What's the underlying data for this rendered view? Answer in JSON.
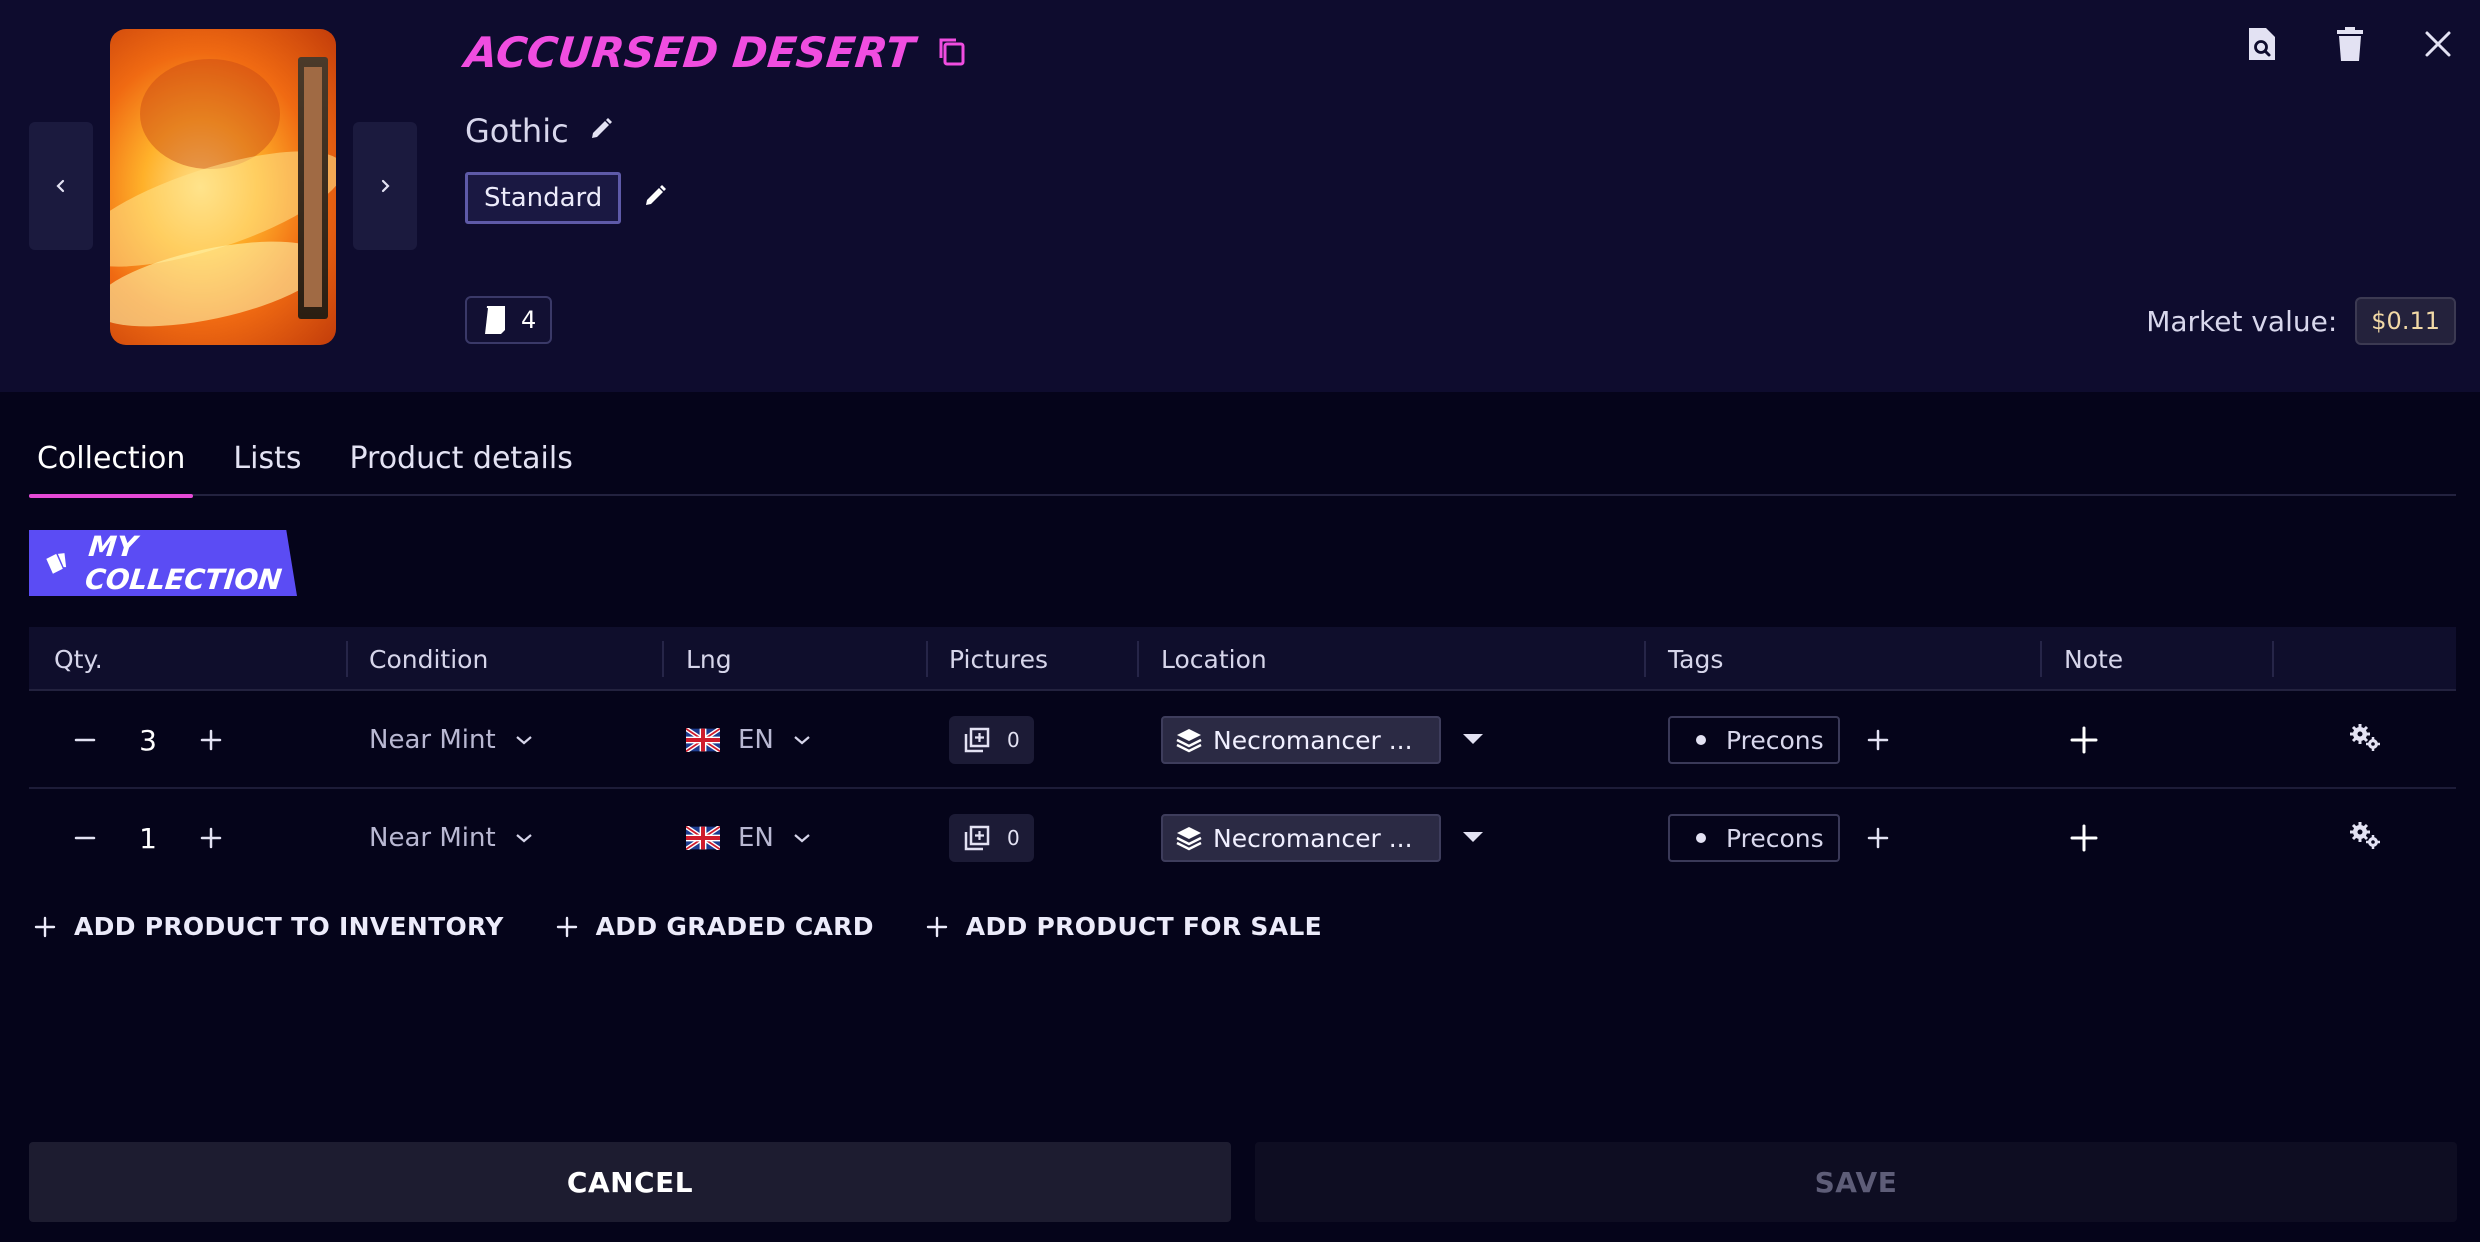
{
  "product": {
    "title": "ACCURSED DESERT",
    "set_name": "Gothic",
    "format": "Standard",
    "count": "4",
    "market_label": "Market value:",
    "market_value": "$0.11"
  },
  "tabs": [
    {
      "label": "Collection",
      "active": true
    },
    {
      "label": "Lists",
      "active": false
    },
    {
      "label": "Product details",
      "active": false
    }
  ],
  "section": {
    "label": "MY COLLECTION"
  },
  "table": {
    "headers": [
      "Qty.",
      "Condition",
      "Lng",
      "Pictures",
      "Location",
      "Tags",
      "Note"
    ],
    "rows": [
      {
        "qty": "3",
        "condition": "Near Mint",
        "language": "EN",
        "pictures": "0",
        "location": "Necromancer ...",
        "tag": "Precons"
      },
      {
        "qty": "1",
        "condition": "Near Mint",
        "language": "EN",
        "pictures": "0",
        "location": "Necromancer ...",
        "tag": "Precons"
      }
    ]
  },
  "actions": {
    "add_inventory": "ADD PRODUCT TO INVENTORY",
    "add_graded": "ADD GRADED CARD",
    "add_for_sale": "ADD PRODUCT FOR SALE"
  },
  "footer": {
    "cancel": "CANCEL",
    "save": "SAVE"
  },
  "colors": {
    "accent_pink": "#e64ad6",
    "title_pink": "#f04de0",
    "badge_purple": "#5b4cf4",
    "background": "#05041a",
    "header_bg": "#0e0c2e"
  },
  "icons": {
    "copy": "copy-icon",
    "edit": "pencil-icon",
    "card": "card-icon",
    "preview": "file-search-icon",
    "delete": "trash-icon",
    "close": "close-icon",
    "layers": "layers-icon",
    "settings": "gears-icon"
  }
}
